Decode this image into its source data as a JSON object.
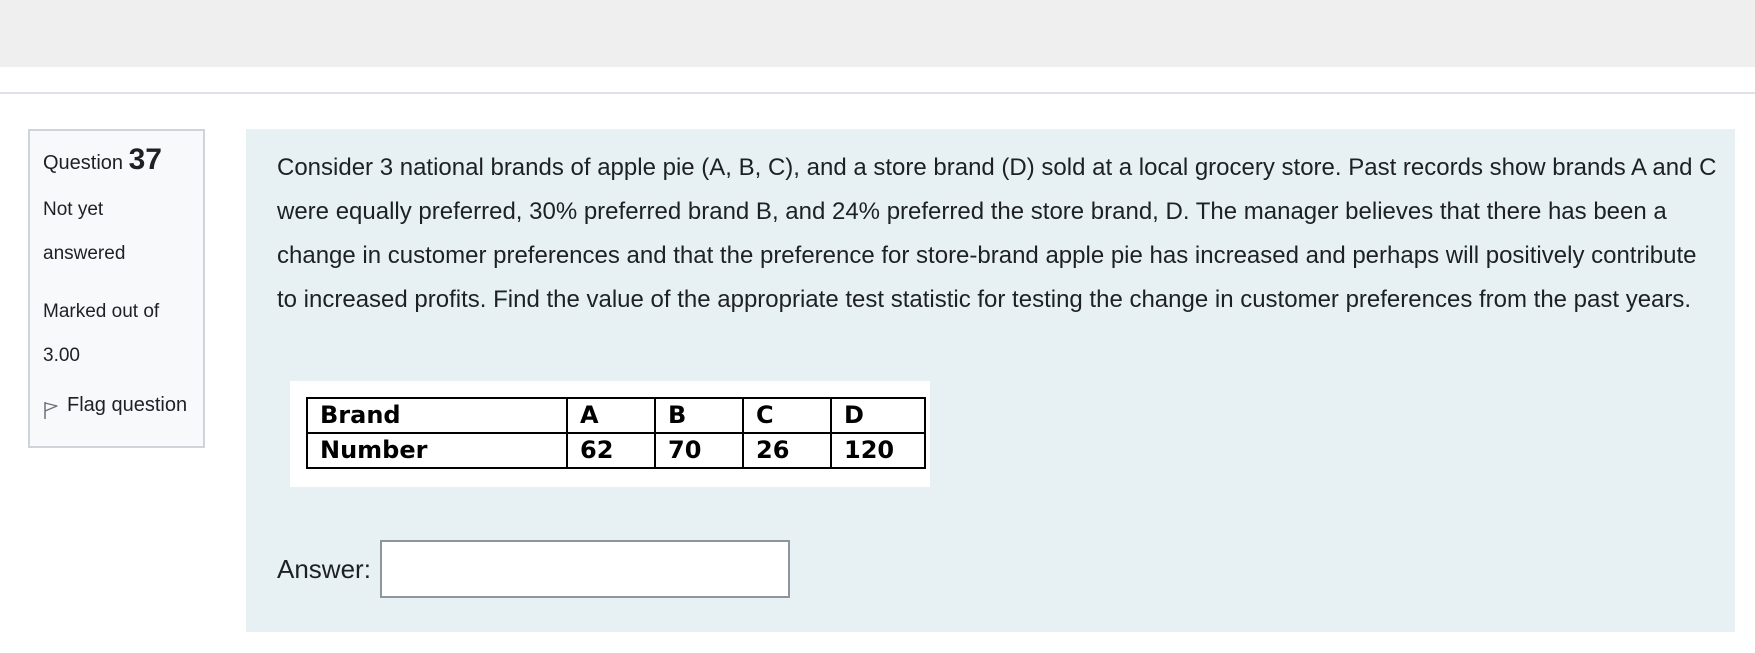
{
  "question_info": {
    "label": "Question",
    "number": "37",
    "state_line1": "Not yet",
    "state_line2": "answered",
    "marks_line1": "Marked out of",
    "marks_line2": "3.00",
    "flag_label": "Flag question",
    "flag_icon": "flag-icon"
  },
  "question": {
    "text": "Consider 3 national brands of apple pie (A, B, C), and a store brand (D) sold at a local grocery store. Past records show brands A and C were equally preferred, 30% preferred brand B, and 24% preferred the store brand, D. The manager believes that there has been a change in customer preferences and that the preference for store-brand apple pie has increased and perhaps will positively contribute to increased profits. Find the value of the appropriate test statistic for testing the change in customer preferences from the past years.",
    "table": {
      "rows": [
        [
          "Brand",
          "A",
          "B",
          "C",
          "D"
        ],
        [
          "Number",
          "62",
          "70",
          "26",
          "120"
        ]
      ]
    }
  },
  "answer": {
    "label": "Answer:",
    "value": "",
    "placeholder": ""
  },
  "colors": {
    "info_bg": "#f8f9fa",
    "content_bg": "#e7f1f4",
    "top_band": "#efefef",
    "link": "#0f6cbf"
  }
}
